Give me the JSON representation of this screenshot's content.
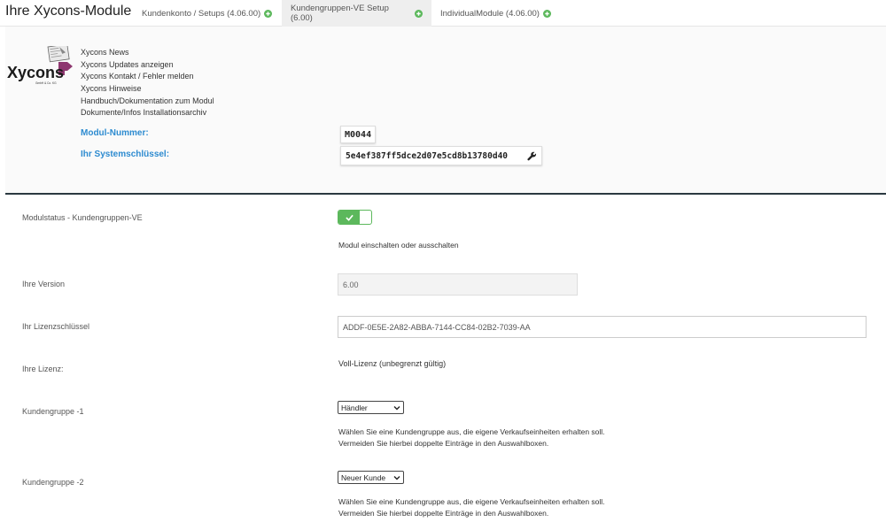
{
  "app": {
    "title": "Ihre Xycons-Module"
  },
  "tabs": [
    {
      "label": "Kundenkonto / Setups (4.06.00)",
      "active": false
    },
    {
      "label": "Kundengruppen-VE Setup (6.00)",
      "active": true
    },
    {
      "label": "IndividualModule (4.06.00)",
      "active": false
    }
  ],
  "header": {
    "logo_text": "Xycons",
    "logo_subtext": "GmbH & Co. KG",
    "links": [
      "Xycons News",
      "Xycons Updates anzeigen",
      "Xycons Kontakt / Fehler melden",
      "Xycons Hinweise",
      "Handbuch/Dokumentation zum Modul",
      "Dokumente/Infos Installationsarchiv"
    ],
    "module_number_label": "Modul-Nummer:",
    "module_number": "M0044",
    "system_key_label": "Ihr Systemschlüssel:",
    "system_key": "5e4ef387ff5dce2d07e5cd8b13780d40"
  },
  "form": {
    "status": {
      "label": "Modulstatus - Kundengruppen-VE",
      "enabled": true,
      "hint": "Modul einschalten oder ausschalten"
    },
    "version": {
      "label": "Ihre Version",
      "value": "6.00"
    },
    "license_key": {
      "label": "Ihr Lizenzschlüssel",
      "value": "ADDF-0E5E-2A82-ABBA-7144-CC84-02B2-7039-AA"
    },
    "license": {
      "label": "Ihre Lizenz:",
      "value": "Voll-Lizenz (unbegrenzt gültig)"
    },
    "group1": {
      "label": "Kundengruppe -1",
      "selected": "Händler",
      "hint_line1": "Wählen Sie eine Kundengruppe aus, die eigene Verkaufseinheiten erhalten soll.",
      "hint_line2": "Vermeiden Sie hierbei doppelte Einträge in den Auswahlboxen."
    },
    "group2": {
      "label": "Kundengruppe -2",
      "selected": "Neuer Kunde",
      "hint_line1": "Wählen Sie eine Kundengruppe aus, die eigene Verkaufseinheiten erhalten soll.",
      "hint_line2": "Vermeiden Sie hierbei doppelte Einträge in den Auswahlboxen."
    }
  },
  "colors": {
    "accent_green": "#5cb85c",
    "label_blue": "#2d8bd0",
    "divider": "#2b3940"
  }
}
